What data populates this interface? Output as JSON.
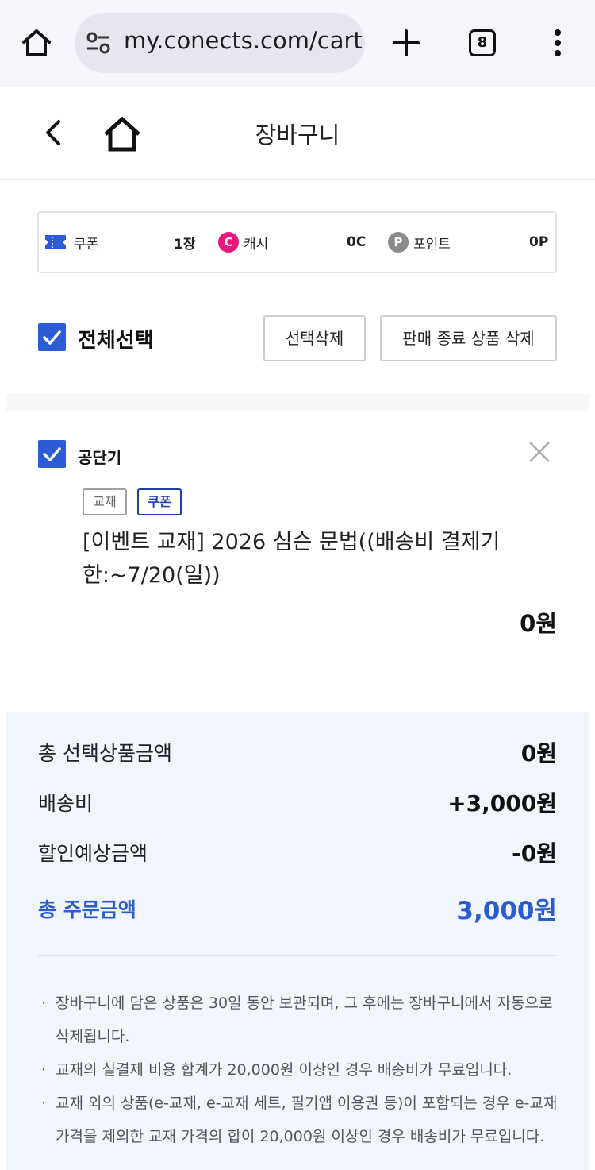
{
  "browser": {
    "url": "my.conects.com/cart",
    "tab_count": "8"
  },
  "header": {
    "title": "장바구니"
  },
  "points": {
    "coupon_label": "쿠폰",
    "coupon_value": "1장",
    "cash_label": "캐시",
    "cash_badge": "C",
    "cash_value": "0C",
    "point_label": "포인트",
    "point_badge": "P",
    "point_value": "0P"
  },
  "select_all": {
    "label": "전체선택",
    "delete_selected": "선택삭제",
    "delete_ended": "판매 종료 상품 삭제"
  },
  "item": {
    "seller": "공단기",
    "tag_type": "교재",
    "tag_coupon": "쿠폰",
    "name": "[이벤트 교재] 2026 심슨 문법((배송비 결제기한:~7/20(일))",
    "price": "0원"
  },
  "summary": {
    "selected_label": "총 선택상품금액",
    "selected_value": "0원",
    "shipping_label": "배송비",
    "shipping_value": "+3,000원",
    "discount_label": "할인예상금액",
    "discount_value": "-0원",
    "total_label": "총 주문금액",
    "total_value": "3,000원"
  },
  "notes": [
    "장바구니에 담은 상품은 30일 동안 보관되며, 그 후에는 장바구니에서 자동으로 삭제됩니다.",
    "교재의 실결제 비용 합계가 20,000원 이상인 경우 배송비가 무료입니다.",
    "교재 외의 상품(e-교재, e-교재 세트, 필기앱 이용권 등)이 포함되는 경우 e-교재 가격을 제외한 교재 가격의 합이 20,000원 이상인 경우 배송비가 무료입니다."
  ],
  "colors": {
    "accent_blue": "#2c5bd6",
    "total_blue": "#2a5cce",
    "cash_pink": "#e8187f",
    "point_gray": "#8a8a8a",
    "summary_bg": "#f1f5fd"
  }
}
